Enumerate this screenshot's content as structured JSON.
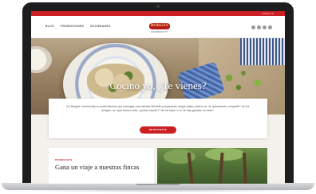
{
  "site": {
    "topbar": {
      "link": "¡Únete! ✉"
    },
    "nav": {
      "items": [
        "BLOG",
        "PROMOCIONES",
        "SOCIEDADES"
      ]
    },
    "logo": {
      "brand": "BORGES",
      "sub": "COMMUNITY"
    },
    "socials": [
      "facebook-icon",
      "twitter-icon",
      "instagram-icon",
      "pinterest-icon"
    ],
    "hero": {
      "title": "Cocino yo, ¿Te vienes?"
    },
    "intro": {
      "text": "En Borges Community no pretendemos que consigas una estrella Michelin preparando ningún plato; para ti un \"te quemamos, compartir\" de tus amigos, un \"qué bueno está, ¿puedo repetir?\" de tus hijos o un \"te has ganado un beso\".",
      "cta": "REGÍSTRATE"
    },
    "promo": {
      "tag": "PROMOCIÓN",
      "title": "Gana un viaje a nuestras fincas"
    },
    "colors": {
      "accent": "#cc1f24",
      "background": "#f4f1ec"
    }
  }
}
